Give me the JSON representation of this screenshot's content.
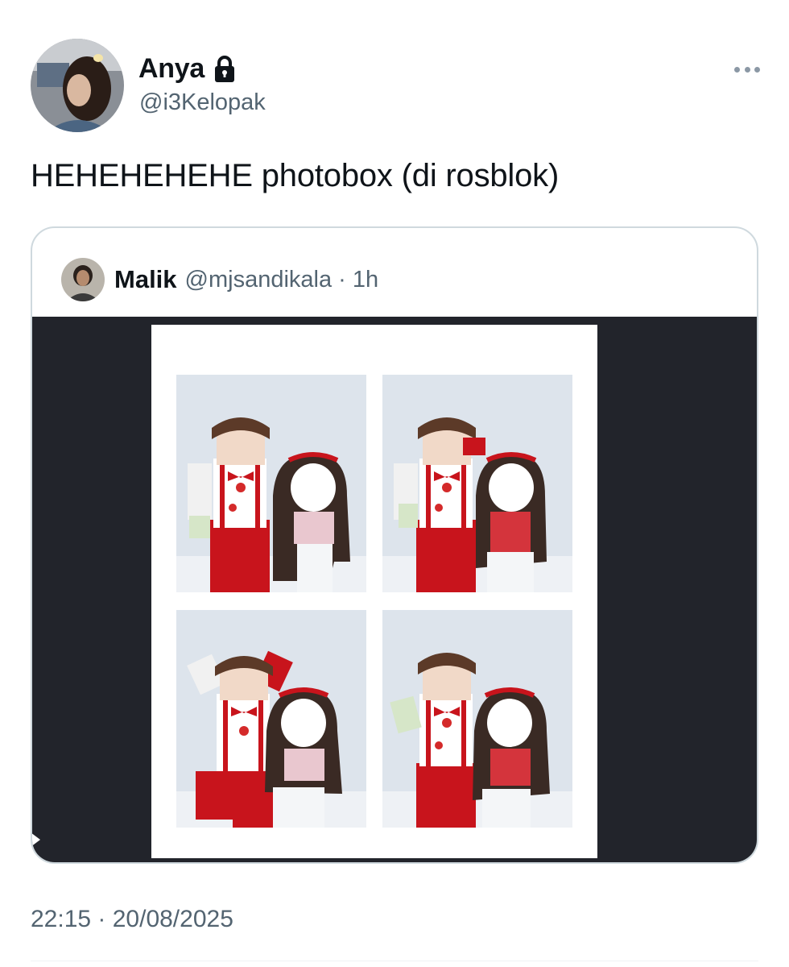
{
  "author": {
    "display_name": "Anya",
    "handle": "@i3Kelopak",
    "protected_icon": "lock-icon",
    "avatar_icon": "user-avatar"
  },
  "menu_icon": "more-horizontal-icon",
  "tweet": {
    "text": "HEHEHEHEHE photobox (di rosblok)",
    "timestamp": "22:15 · 20/08/2025"
  },
  "quoted": {
    "name": "Malik",
    "handle_time": "@mjsandikala · 1h",
    "avatar_icon": "user-avatar",
    "media": {
      "type": "photobooth-strip",
      "frames": 4
    }
  },
  "colors": {
    "text": "#0f1419",
    "secondary": "#536471",
    "border": "#cfd9de",
    "media_bg": "#22242b",
    "outfit_red": "#c8141c"
  }
}
